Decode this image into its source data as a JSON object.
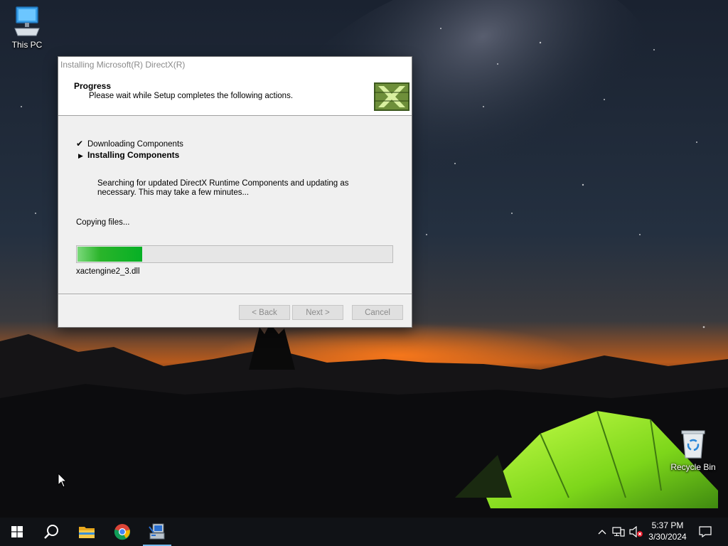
{
  "desktop": {
    "this_pc_label": "This PC",
    "recycle_bin_label": "Recycle Bin"
  },
  "dialog": {
    "title": "Installing Microsoft(R) DirectX(R)",
    "header_title": "Progress",
    "header_subtitle": "Please wait while Setup completes the following actions.",
    "steps": [
      {
        "label": "Downloading Components",
        "state": "done",
        "icon": "checkmark-icon"
      },
      {
        "label": "Installing Components",
        "state": "current",
        "icon": "arrow-right-icon"
      }
    ],
    "description": "Searching for updated DirectX Runtime Components and updating as necessary. This may take a few minutes...",
    "status": "Copying files...",
    "progress_percent": 21,
    "current_file": "xactengine2_3.dll",
    "buttons": {
      "back": "< Back",
      "next": "Next >",
      "cancel": "Cancel"
    },
    "accent_color": "#06b025"
  },
  "taskbar": {
    "apps": [
      "windows-start-icon",
      "search-icon",
      "file-explorer-icon",
      "chrome-icon",
      "directx-setup-icon"
    ],
    "tray_icons": [
      "chevron-up-icon",
      "network-icon",
      "volume-muted-icon"
    ],
    "time": "5:37 PM",
    "date": "3/30/2024"
  }
}
